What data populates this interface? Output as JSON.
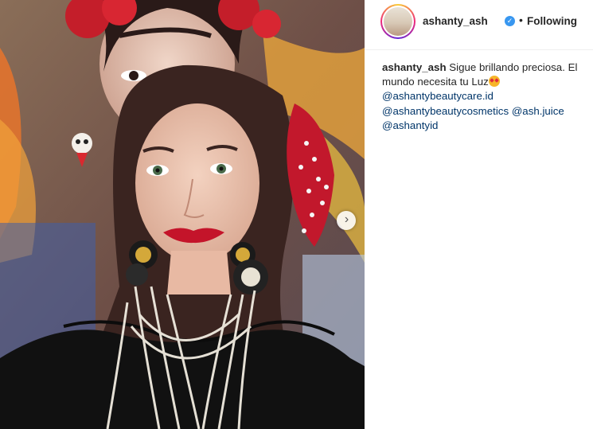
{
  "post": {
    "username": "ashanty_ash",
    "follow_separator": "•",
    "follow_status": "Following",
    "caption": {
      "username": "ashanty_ash",
      "text": "Sigue brillando preciosa. El mundo necesita tu Luz",
      "emoji": "star-struck-emoji",
      "mentions": [
        "@ashantybeautycare.id",
        "@ashantybeautycosmetics",
        "@ash.juice",
        "@ashantyid"
      ]
    },
    "carousel": {
      "next_icon": "chevron-right-icon",
      "next_glyph": "›"
    },
    "verified_icon": "verified-badge-icon",
    "verified_glyph": "✓",
    "colors": {
      "accent": "#3897f0",
      "text": "#262626",
      "link": "#003569",
      "border": "#efefef"
    }
  }
}
